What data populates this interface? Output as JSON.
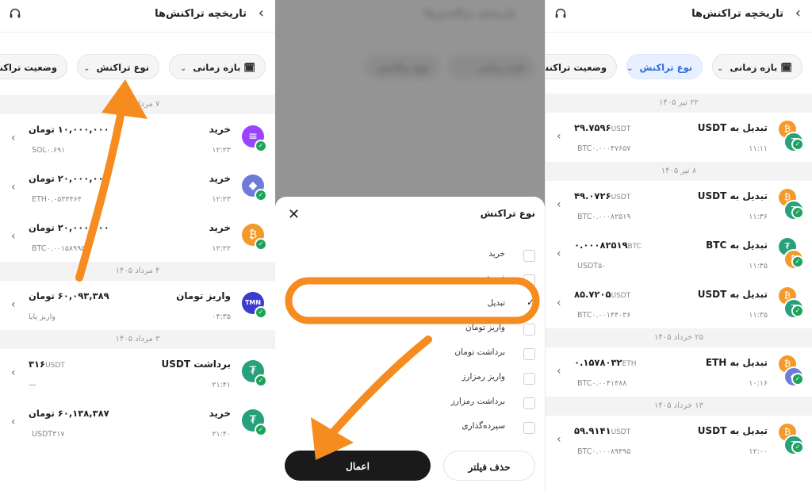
{
  "header": {
    "title": "تاریخچه تراکنش‌ها"
  },
  "filters": {
    "period": "بازه زمانی",
    "type": "نوع تراکنش",
    "status": "وضعیت تراکنش"
  },
  "left": {
    "groups": [
      {
        "date": "۷ مرداد ۱۴۰۵",
        "rows": [
          {
            "title": "خرید",
            "time": "۱۲:۲۳",
            "amount": "۱۰,۰۰۰,۰۰۰ تومان",
            "sub": "۰.۶۹۱",
            "sub_unit": "SOL"
          },
          {
            "title": "خرید",
            "time": "۱۲:۲۳",
            "amount": "۲۰,۰۰۰,۰۰۰ تومان",
            "sub": "۰.۰۵۳۴۴۶۴",
            "sub_unit": "ETH"
          },
          {
            "title": "خرید",
            "time": "۱۲:۲۲",
            "amount": "۲۰,۰۰۰,۰۰۰ تومان",
            "sub": "۰.۰۰۱۵۸۹۹۵",
            "sub_unit": "BTC"
          }
        ]
      },
      {
        "date": "۴ مرداد ۱۴۰۵",
        "rows": [
          {
            "title": "واریز تومان",
            "time": "۰۴:۳۵",
            "amount": "۶۰,۰۹۳,۳۸۹ تومان",
            "sub": "واریز پایا",
            "sub_unit": ""
          }
        ]
      },
      {
        "date": "۳ مرداد ۱۴۰۵",
        "rows": [
          {
            "title": "برداشت USDT",
            "time": "۲۱:۴۱",
            "amount": "۳۱۶",
            "amount_unit": "USDT",
            "sub": "—",
            "sub_unit": ""
          },
          {
            "title": "خرید",
            "time": "۲۱:۴۰",
            "amount": "۶۰,۱۳۸,۳۸۷ تومان",
            "sub": "۳۱۷",
            "sub_unit": "USDT"
          }
        ]
      }
    ]
  },
  "coins": {
    "TMN": "TMN"
  },
  "sheet": {
    "title": "نوع تراکنش",
    "options": [
      "خرید",
      "فروش",
      "تبدیل",
      "واریز تومان",
      "برداشت تومان",
      "واریز رمزارز",
      "برداشت رمزارز",
      "سپرده‌گذاری"
    ],
    "checked_index": 2,
    "apply": "اعمال",
    "clear": "حذف فیلتر"
  },
  "right": {
    "groups": [
      {
        "date": "۲۲ تیر ۱۴۰۵",
        "rows": [
          {
            "title": "تبدیل به USDT",
            "time": "۱۱:۱۱",
            "amount": "۲۹.۷۵۹۶",
            "amount_unit": "USDT",
            "sub": "۰.۰۰۰۴۷۶۵۷",
            "sub_unit": "BTC"
          }
        ]
      },
      {
        "date": "۸ تیر ۱۴۰۵",
        "rows": [
          {
            "title": "تبدیل به USDT",
            "time": "۱۱:۳۶",
            "amount": "۴۹.۰۷۲۶",
            "amount_unit": "USDT",
            "sub": "۰.۰۰۰۸۲۵۱۹",
            "sub_unit": "BTC"
          },
          {
            "title": "تبدیل به BTC",
            "time": "۱۱:۳۵",
            "amount": "۰.۰۰۰۸۲۵۱۹",
            "amount_unit": "BTC",
            "sub": "۵۰",
            "sub_unit": "USDT"
          },
          {
            "title": "تبدیل به USDT",
            "time": "۱۱:۳۵",
            "amount": "۸۵.۷۲۰۵",
            "amount_unit": "USDT",
            "sub": "۰.۰۰۱۴۴۰۳۶",
            "sub_unit": "BTC"
          }
        ]
      },
      {
        "date": "۲۵ خرداد ۱۴۰۵",
        "rows": [
          {
            "title": "تبدیل به ETH",
            "time": "۱۰:۱۶",
            "amount": "۰.۱۵۷۸۰۳۲",
            "amount_unit": "ETH",
            "sub": "۰.۰۰۴۱۴۸۸",
            "sub_unit": "BTC"
          }
        ]
      },
      {
        "date": "۱۳ خرداد ۱۴۰۵",
        "rows": [
          {
            "title": "تبدیل به USDT",
            "time": "۱۲:۰۰",
            "amount": "۵۹.۹۱۴۱",
            "amount_unit": "USDT",
            "sub": "۰.۰۰۰۸۹۴۹۵",
            "sub_unit": "BTC"
          }
        ]
      }
    ]
  },
  "colors": {
    "orange": "#f68b1f",
    "green": "#1fa35a",
    "blue": "#2d6cdf",
    "sol": "#9945ff",
    "eth": "#6f7bd9",
    "btc": "#f39a2b",
    "usdt": "#26a17b",
    "tmn": "#3b3bd1"
  }
}
